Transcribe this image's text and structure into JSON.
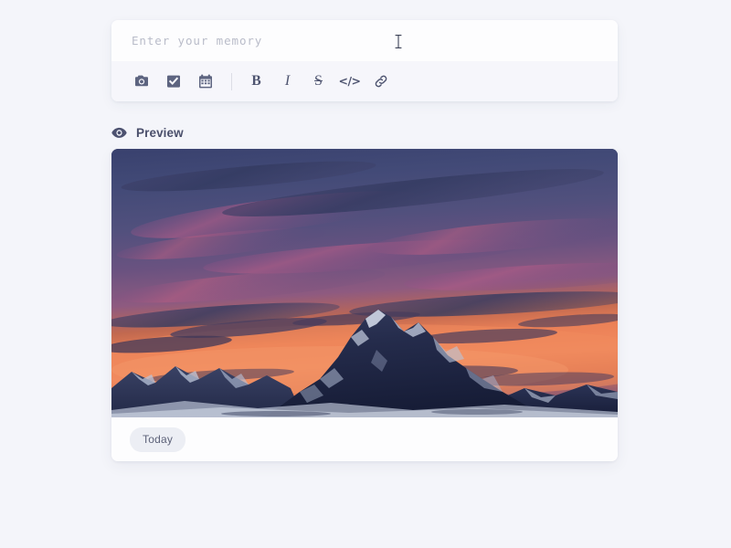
{
  "page": {
    "background_color": "#f4f5fa"
  },
  "editor": {
    "input": {
      "placeholder": "Enter your memory",
      "value": "",
      "caret_icon": "text-cursor-i-beam"
    },
    "toolbar": {
      "media_tools": [
        {
          "name": "camera-icon",
          "label": "Add photo"
        },
        {
          "name": "checkbox-icon",
          "label": "Add checklist"
        },
        {
          "name": "calendar-icon",
          "label": "Add date"
        }
      ],
      "format_tools": [
        {
          "name": "bold-icon",
          "glyph": "B",
          "label": "Bold"
        },
        {
          "name": "italic-icon",
          "glyph": "I",
          "label": "Italic"
        },
        {
          "name": "strikethrough-icon",
          "glyph": "S",
          "label": "Strikethrough"
        },
        {
          "name": "code-icon",
          "glyph": "</>",
          "label": "Code"
        },
        {
          "name": "link-icon",
          "glyph": "",
          "label": "Link"
        }
      ]
    }
  },
  "preview": {
    "icon": "eye-icon",
    "title": "Preview",
    "card": {
      "image": {
        "alt": "Sunset over snow-capped mountain peaks",
        "colors": {
          "sky_top": "#3c4474",
          "sky_upper_mid": "#5b4f7e",
          "sky_magenta": "#9a5f85",
          "sky_orange": "#e8764f",
          "sky_hot": "#f4825a",
          "mountain_dark": "#232a48",
          "snow": "#cdd6e6"
        }
      },
      "date_badge": "Today"
    }
  },
  "colors": {
    "card_background": "#fdfdfe",
    "toolbar_background": "#f6f6fb",
    "icon_color": "#5d6480",
    "text_primary": "#4a4f6b",
    "text_placeholder": "#b9bcc9",
    "badge_background": "#eceef4"
  }
}
